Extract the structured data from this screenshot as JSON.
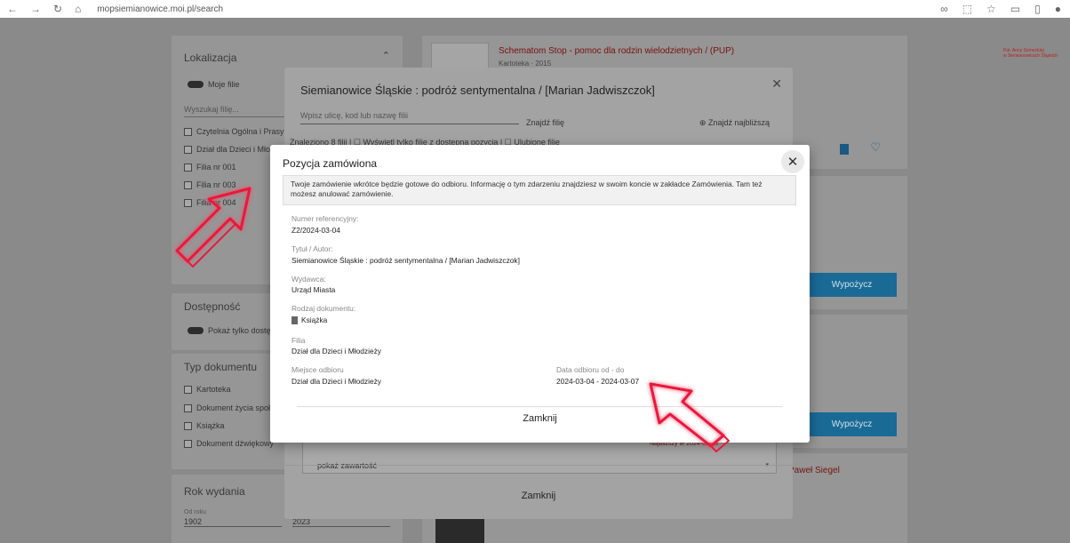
{
  "browser": {
    "url": "mopsiemianowice.moi.pl/search"
  },
  "sidebar": {
    "location_title": "Lokalizacja",
    "my_branches": "Moje filie",
    "search_branch_placeholder": "Wyszukaj filię...",
    "branches": [
      "Czytelnia Ogólna i Prasy",
      "Dział dla Dzieci i Mło",
      "Filia nr 001",
      "Filia nr 003",
      "Filia nr 004"
    ],
    "availability_title": "Dostępność",
    "availability_toggle": "Pokaż tylko dostę",
    "doctype_title": "Typ dokumentu",
    "doctypes": [
      "Kartoteka",
      "Dokument życia społ",
      "Książka",
      "Dokument dźwiękowy"
    ],
    "year_title": "Rok wydania",
    "year_from_label": "Od roku",
    "year_from": "1902",
    "year_to": "2023"
  },
  "results": {
    "first_title": "Schematom Stop - pomoc dla rodzin wielodzietnych / (PUP)",
    "first_meta": "Kartoteka · 2015",
    "borrow_label": "Wypożycz",
    "third_author": "Paweł Siegel",
    "nearest_date": "Najbliższy te 2024-03-23"
  },
  "logo": {
    "line1": "Pat. Anny Semeckiej",
    "line2": "w Siemianowicach Śląskich"
  },
  "branch_modal": {
    "title": "Siemianowice Śląskie : podróż sentymentalna / [Marian Jadwiszczok]",
    "address_placeholder": "Wpisz ulicę, kod lub nazwę filii",
    "find_branch": "Znajdź filię",
    "find_nearest": "Znajdź najbliższą",
    "found_text": "Znaleziono 8 filii  |  ☐ Wyświetl tylko filie z dostępną pozycją  |  ☐ Ulubione filie",
    "show_content": "pokaż zawartość",
    "close_label": "Zamknij"
  },
  "order_modal": {
    "title": "Pozycja zamówiona",
    "info": "Twoje zamówienie wkrótce będzie gotowe do odbioru. Informację o tym zdarzeniu znajdziesz w swoim koncie w zakładce Zamówienia. Tam też możesz anulować zamówienie.",
    "ref_label": "Numer referencyjny:",
    "ref_value": "Z2/2024-03-04",
    "title_label": "Tytuł / Autor:",
    "title_value": "Siemianowice Śląskie : podróż sentymentalna / [Marian Jadwiszczok]",
    "publisher_label": "Wydawca:",
    "publisher_value": "Urząd Miasta",
    "doctype_label": "Rodzaj dokumentu:",
    "doctype_value": "Książka",
    "branch_label": "Filia",
    "branch_value": "Dział dla Dzieci i Młodzieży",
    "pickup_label": "Miejsce odbioru",
    "pickup_value": "Dział dla Dzieci i Młodzieży",
    "dates_label": "Data odbioru od - do",
    "dates_value": "2024-03-04 - 2024-03-07",
    "close_label": "Zamknij"
  },
  "colors": {
    "arrow": "#e8193c",
    "button": "#1a6a96"
  }
}
